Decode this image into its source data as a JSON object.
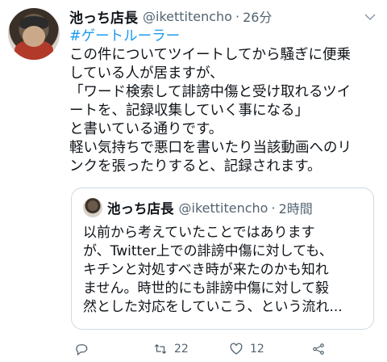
{
  "tweet": {
    "name": "池っち店長",
    "handle": "@ikettitencho",
    "dot": "·",
    "time": "26分",
    "hashtag": "#ゲートルーラー",
    "lines": [
      "この件についてツイートしてから騒ぎに便乗",
      "している人が居ますが、",
      "「ワード検索して誹謗中傷と受け取れるツイ",
      "ートを、記録収集していく事になる」",
      "と書いている通りです。",
      "軽い気持ちで悪口を書いたり当該動画へのリ",
      "ンクを張ったりすると、記録されます。"
    ]
  },
  "quote": {
    "name": "池っち店長",
    "handle": "@ikettitencho",
    "dot": "·",
    "time": "2時間",
    "lines": [
      "以前から考えていたことではあります",
      "が、Twitter上での誹謗中傷に対しても、",
      "キチンと対処すべき時が来たのかも知れ",
      "ません。時世的にも誹謗中傷に対して毅",
      "然とした対応をしていこう、という流れ..."
    ]
  },
  "actions": {
    "retweet_count": "22",
    "like_count": "12",
    "icons": [
      "reply-icon",
      "retweet-icon",
      "like-icon",
      "share-icon"
    ]
  },
  "colors": {
    "accent": "#1d9bf0",
    "muted": "#536471",
    "border": "#cfd9de"
  }
}
